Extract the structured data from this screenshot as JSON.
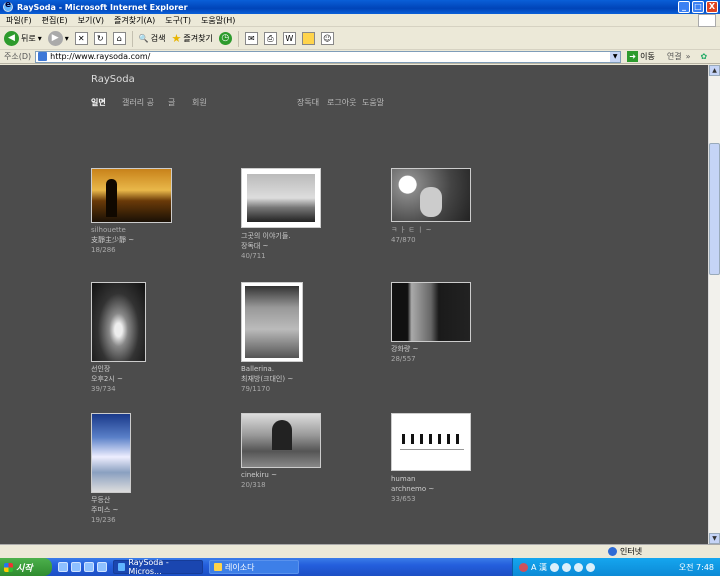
{
  "window": {
    "title": "RaySoda - Microsoft Internet Explorer",
    "buttons": {
      "minimize": "_",
      "maximize": "□",
      "close": "X"
    }
  },
  "menu": [
    "파일(F)",
    "편집(E)",
    "보기(V)",
    "즐겨찾기(A)",
    "도구(T)",
    "도움말(H)"
  ],
  "toolbar": {
    "back_label": "뒤로",
    "search_label": "검색",
    "favorites_label": "즐겨찾기"
  },
  "address": {
    "label": "주소(D)",
    "url": "http://www.raysoda.com/",
    "go_label": "이동",
    "links_label": "연결"
  },
  "site": {
    "title": "RaySoda",
    "nav": [
      "일면",
      "갤러리 공",
      "글",
      "회원"
    ],
    "nav_right": [
      "장독대",
      "로그아웃",
      "도움말"
    ]
  },
  "cards": [
    {
      "line1": "silhouette",
      "line2": "支靜主少靜 ~",
      "line3": "18/286"
    },
    {
      "line1": "그곳의 이야기들.",
      "line2": "장독대 ~",
      "line3": "40/711"
    },
    {
      "line1": "",
      "line2": "ㅋ ㅏ ㅌ ㅣ ~",
      "line3": "47/870"
    },
    {
      "line1": "",
      "line2": "선인장",
      "line3": "오후2시 ~",
      "line4": "39/734"
    },
    {
      "line1": "",
      "line2": "Ballerina.",
      "line3": "최재방(크대인) ~",
      "line4": "79/1170"
    },
    {
      "line1": "",
      "line2": "",
      "line3": "강화량 ~",
      "line4": "28/557"
    },
    {
      "line1": "",
      "line2": "무등산",
      "line3": "주미스 ~",
      "line4": "19/236"
    },
    {
      "line1": "",
      "line2": "",
      "line3": "cinekiru ~",
      "line4": "20/318"
    },
    {
      "line1": "",
      "line2": "human",
      "line3": "archnemo ~",
      "line4": "33/653"
    }
  ],
  "status": {
    "zone": "인터넷"
  },
  "taskbar": {
    "start": "시작",
    "tasks": [
      "RaySoda - Micros...",
      "레이소다"
    ],
    "clock": "오전 7:48",
    "ime": "A 漢"
  },
  "colors": {
    "page_bg": "#4c4c4c",
    "titlebar": "#0a5fd8",
    "taskbar": "#245edc"
  }
}
